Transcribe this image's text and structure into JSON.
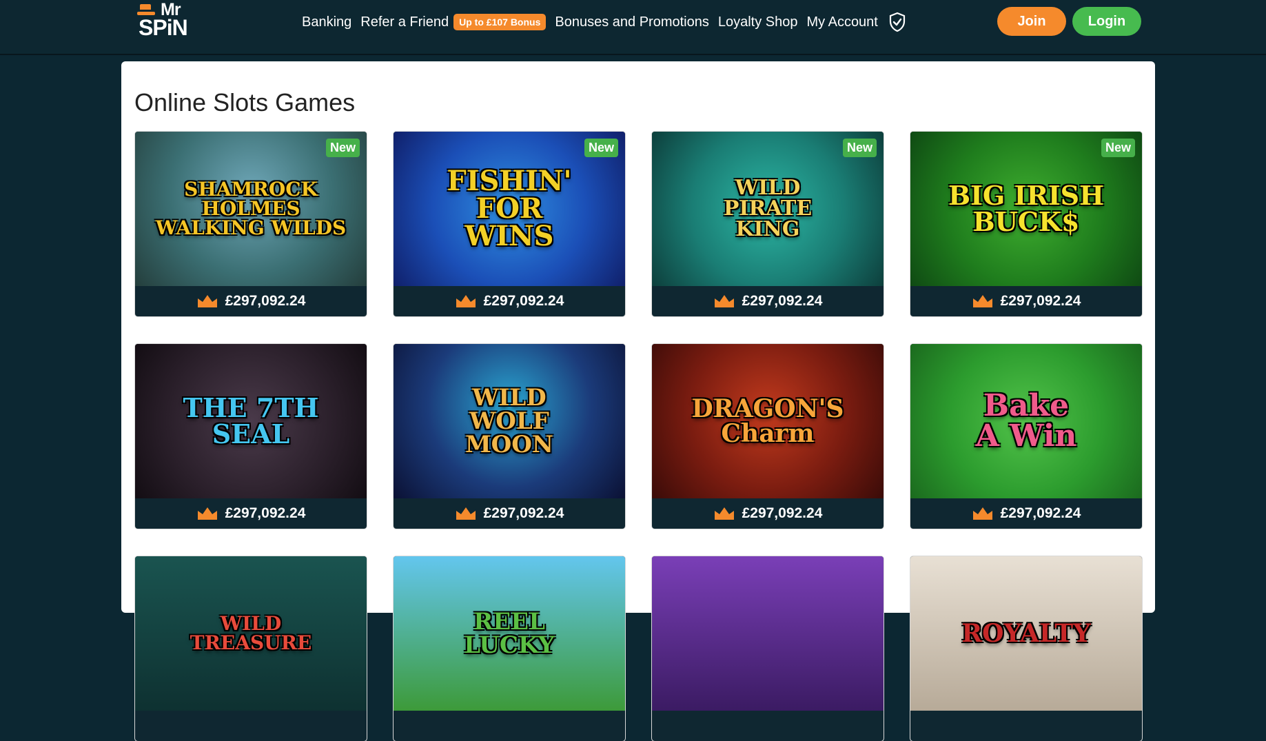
{
  "brand": {
    "logo_top": "Mr",
    "logo_bottom": "SPiN"
  },
  "nav": {
    "items": [
      "Banking",
      "Refer a Friend",
      "Bonuses and Promotions",
      "Loyalty Shop",
      "My Account"
    ],
    "refer_bonus_badge": "Up to £107 Bonus"
  },
  "auth": {
    "join_label": "Join",
    "login_label": "Login"
  },
  "page": {
    "title": "Online Slots Games"
  },
  "games": [
    {
      "title": "SHAMROCK HOLMES\nWALKING WILDS",
      "badge": "New",
      "jackpot": "£297,092.24",
      "title_color": "#f5c526"
    },
    {
      "title": "FISHIN'\nFOR\nWINS",
      "badge": "New",
      "jackpot": "£297,092.24",
      "title_color": "#f3d027"
    },
    {
      "title": "WILD\nPIRATE\nKING",
      "badge": "New",
      "jackpot": "£297,092.24",
      "title_color": "#f4d25b"
    },
    {
      "title": "BIG IRISH\nBUCK$",
      "badge": "New",
      "jackpot": "£297,092.24",
      "title_color": "#f6e22e"
    },
    {
      "title": "THE 7TH SEAL",
      "badge": "",
      "jackpot": "£297,092.24",
      "title_color": "#45c6f0"
    },
    {
      "title": "WILD\nWOLF\nMOON",
      "badge": "",
      "jackpot": "£297,092.24",
      "title_color": "#f1b74a"
    },
    {
      "title": "DRAGON'S\nCharm",
      "badge": "",
      "jackpot": "£297,092.24",
      "title_color": "#f7a53a"
    },
    {
      "title": "Bake\nA Win",
      "badge": "",
      "jackpot": "£297,092.24",
      "title_color": "#f05b8b"
    },
    {
      "title": "WILD\nTREASURE",
      "badge": "",
      "jackpot": "",
      "title_color": "#e84b3b"
    },
    {
      "title": "REEL\nLUCKY",
      "badge": "",
      "jackpot": "",
      "title_color": "#5bbf44"
    },
    {
      "title": "",
      "badge": "",
      "jackpot": "",
      "title_color": "#ffffff"
    },
    {
      "title": "ROYALTY",
      "badge": "",
      "jackpot": "",
      "title_color": "#c62828"
    }
  ],
  "colors": {
    "header_bg": "#0d2731",
    "accent_orange": "#f58a2c",
    "accent_green": "#47bb4f",
    "card_footer": "#0f2731"
  },
  "icons": {
    "shield": "shield-check-icon",
    "crown": "crown-icon"
  }
}
